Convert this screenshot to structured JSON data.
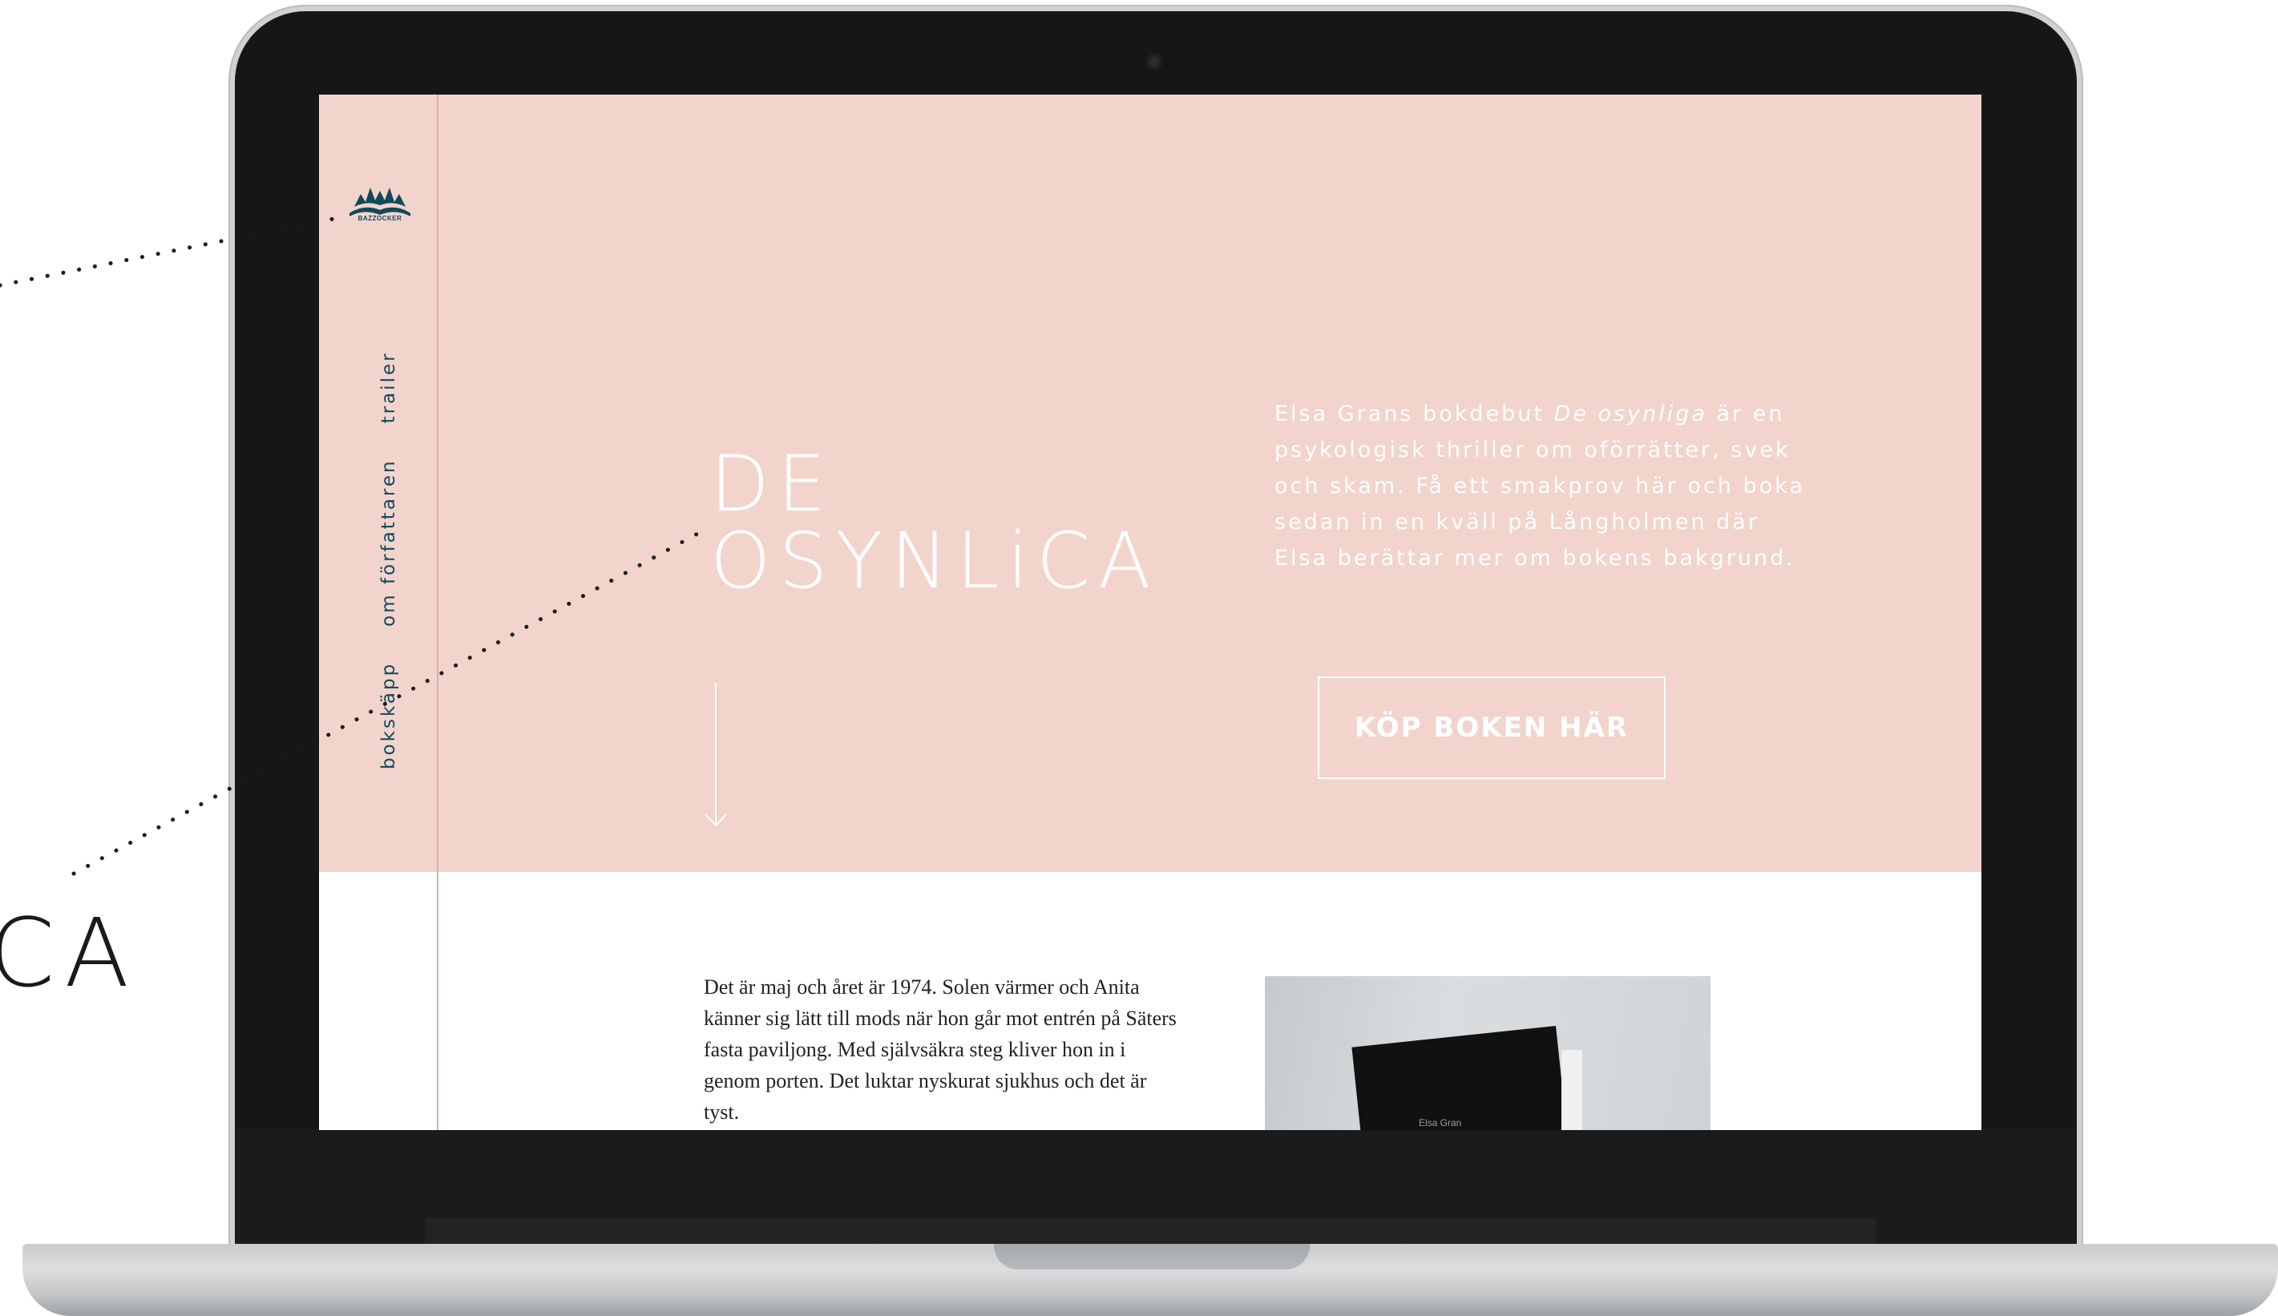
{
  "sidebar": {
    "logo_text": "BAZZOCKER",
    "nav": [
      "bokskäpp",
      "om författaren",
      "trailer"
    ]
  },
  "hero": {
    "title_line1": "DE",
    "title_line2": "OSYNLiCA",
    "author_lead": "Elsa Grans bokdebut ",
    "book_title_italic": "De osynliga",
    "description_rest": " är en psykologisk thriller om oförrätter, svek och skam. Få ett smakprov här och boka sedan in en kväll på Långholmen där Elsa berättar mer om bokens bakgrund.",
    "buy_button": "KÖP BOKEN HÄR"
  },
  "excerpt": {
    "text": "Det är maj och året är 1974. Solen värmer och Anita känner sig lätt till mods när hon går mot entrén på Säters fasta paviljong. Med självsäkra steg kliver hon in i genom porten. Det luktar nyskurat sjukhus och det är tyst."
  },
  "book_photo": {
    "author_label": "Elsa Gran"
  },
  "callout": {
    "title_fragment": "CA"
  },
  "colors": {
    "hero_bg": "#f2d4cd",
    "brand": "#0f4a5a",
    "text_light": "#ffffff"
  }
}
